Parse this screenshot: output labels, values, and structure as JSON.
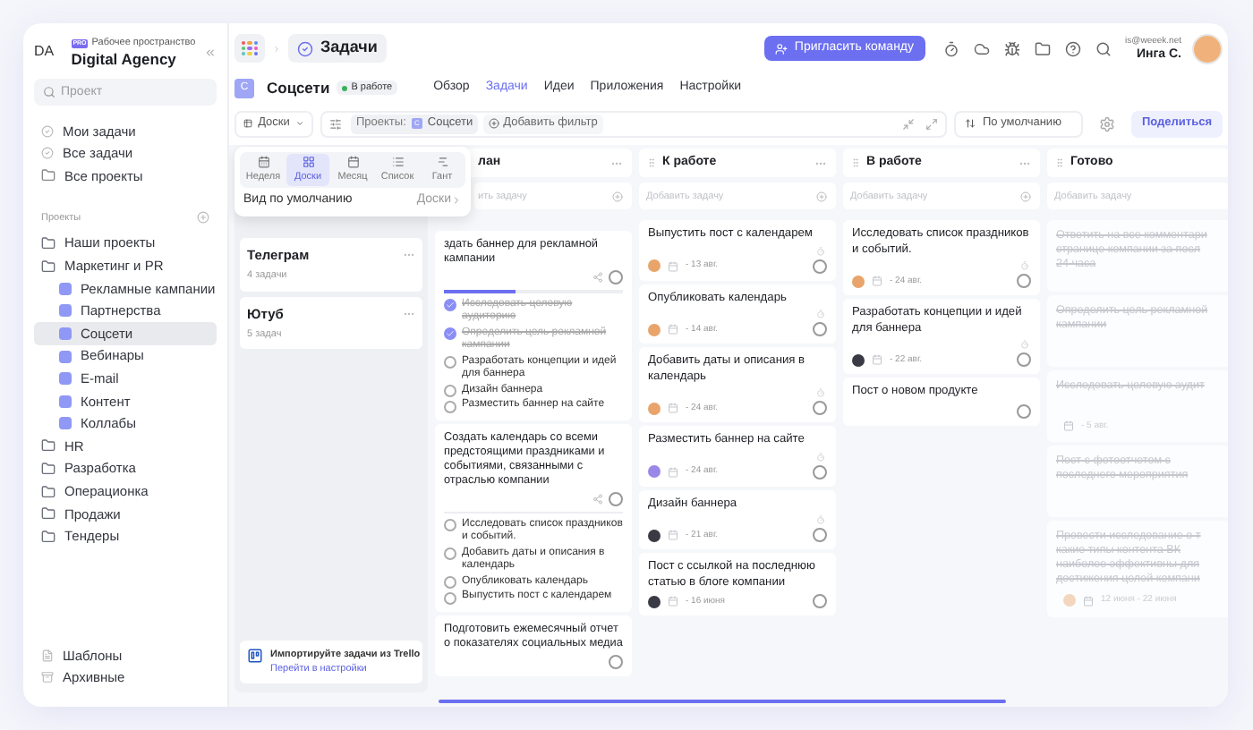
{
  "sidebar": {
    "workspace_initials": "DA",
    "badge": "PRO",
    "workspace_label": "Рабочее пространство",
    "workspace_name": "Digital Agency",
    "search": {
      "placeholder": "Проект"
    },
    "nav": [
      {
        "label": "Мои задачи",
        "kind": "task"
      },
      {
        "label": "Все задачи",
        "kind": "task"
      },
      {
        "label": "Все проекты",
        "kind": "folder"
      }
    ],
    "projects_label": "Проекты",
    "projects": [
      {
        "label": "Наши проекты",
        "selected": false
      },
      {
        "label": "Маркетинг и PR",
        "selected": false,
        "children": [
          {
            "label": "Рекламные кампании",
            "selected": false
          },
          {
            "label": "Партнерства",
            "selected": false
          },
          {
            "label": "Соцсети",
            "selected": true
          },
          {
            "label": "Вебинары",
            "selected": false
          },
          {
            "label": "E-mail",
            "selected": false
          },
          {
            "label": "Контент",
            "selected": false
          },
          {
            "label": "Коллабы",
            "selected": false
          }
        ]
      },
      {
        "label": "HR",
        "selected": false
      },
      {
        "label": "Разработка",
        "selected": false
      },
      {
        "label": "Операционка",
        "selected": false
      },
      {
        "label": "Продажи",
        "selected": false
      },
      {
        "label": "Тендеры",
        "selected": false
      }
    ],
    "footer": [
      {
        "label": "Шаблоны",
        "kind": "templates"
      },
      {
        "label": "Архивные",
        "kind": "archive"
      }
    ]
  },
  "header": {
    "breadcrumb": "Задачи",
    "invite_button": "Пригласить команду",
    "user": {
      "email": "is@weeek.net",
      "name": "Инга С."
    }
  },
  "project": {
    "icon_letter": "С",
    "title": "Соцсети",
    "status": "В работе",
    "tabs": [
      {
        "label": "Обзор",
        "selected": false
      },
      {
        "label": "Задачи",
        "selected": true
      },
      {
        "label": "Идеи",
        "selected": false
      },
      {
        "label": "Приложения",
        "selected": false
      },
      {
        "label": "Настройки",
        "selected": false
      }
    ]
  },
  "toolbar": {
    "view": "Доски",
    "filter_label": "Проекты:",
    "filter_chip": {
      "icon_letter": "С",
      "label": "Соцсети"
    },
    "add_filter": "Добавить фильтр",
    "sort": "По умолчанию",
    "share_button": "Поделиться"
  },
  "view_menu": {
    "options": [
      {
        "label": "Неделя",
        "kind": "week",
        "selected": false
      },
      {
        "label": "Доски",
        "kind": "boards",
        "selected": true
      },
      {
        "label": "Месяц",
        "kind": "month",
        "selected": false
      },
      {
        "label": "Список",
        "kind": "list",
        "selected": false
      },
      {
        "label": "Гант",
        "kind": "gantt",
        "selected": false
      }
    ],
    "default_label": "Вид по умолчанию",
    "default_value": "Доски"
  },
  "boards": [
    {
      "title": "Телеграм",
      "count": "4 задачи"
    },
    {
      "title": "Ютуб",
      "count": "5 задач"
    }
  ],
  "trello": {
    "text": "Импортируйте задачи из Trello",
    "link": "Перейти в настройки"
  },
  "columns": [
    {
      "kind": "checklist",
      "title": "лан",
      "add_placeholder": "ить задачу",
      "cards": [
        {
          "title": "здать баннер для рекламной кампании",
          "share": true,
          "progress": {
            "level": 0.4
          },
          "subtasks": [
            {
              "label": "Исследовать целевую аудиторию",
              "checked": true
            },
            {
              "label": "Определить цель рекламной кампании",
              "checked": true
            },
            {
              "label": "Разработать концепции и идей для баннера",
              "checked": false
            },
            {
              "label": "Дизайн баннера",
              "checked": false
            },
            {
              "label": "Разместить баннер на сайте",
              "checked": false
            }
          ]
        },
        {
          "title": "Создать календарь со всеми предстоящими праздниками и событиями, связанными с отраслью компании",
          "share": true,
          "subtasks": [
            {
              "label": "Исследовать список праздников и событий.",
              "checked": false
            },
            {
              "label": "Добавить даты и описания в календарь",
              "checked": false
            },
            {
              "label": "Опубликовать календарь",
              "checked": false
            },
            {
              "label": "Выпустить пост с календарем",
              "checked": false
            }
          ]
        },
        {
          "title": "Подготовить ежемесячный отчет о показателях социальных медиа",
          "share": false
        }
      ]
    },
    {
      "kind": "tasks",
      "title": "К работе",
      "add_placeholder": "Добавить задачу",
      "cards": [
        {
          "title": "Выпустить пост с календарем",
          "assignee": {
            "color": "#e8a46a"
          },
          "date": "- 13 авг.",
          "timer": true
        },
        {
          "title": "Опубликовать календарь",
          "assignee": {
            "color": "#e8a46a"
          },
          "date": "- 14 авг.",
          "timer": true
        },
        {
          "title": "Добавить даты и описания в календарь",
          "assignee": {
            "color": "#e8a46a"
          },
          "date": "- 24 авг.",
          "timer": true
        },
        {
          "title": "Разместить баннер на сайте",
          "assignee": {
            "color": "#9b87e8"
          },
          "date": "- 24 авг.",
          "timer": true
        },
        {
          "title": "Дизайн баннера",
          "assignee": {
            "color": "#3a3a44"
          },
          "date": "- 21 авг.",
          "timer": true
        },
        {
          "title": "Пост с ссылкой на последнюю статью в блоге компании",
          "assignee": {
            "color": "#3a3a44"
          },
          "date": "- 16 июня",
          "timer": false
        }
      ]
    },
    {
      "kind": "tasks",
      "title": "В работе",
      "add_placeholder": "Добавить задачу",
      "cards": [
        {
          "title": "Исследовать список праздников и событий.",
          "assignee": {
            "color": "#e8a46a"
          },
          "date": "- 24 авг.",
          "timer": true
        },
        {
          "title": "Разработать концепции и идей для баннера",
          "assignee": {
            "color": "#3a3a44"
          },
          "date": "- 22 авг.",
          "timer": true
        },
        {
          "title": "Пост о новом продукте",
          "timer": false
        }
      ]
    },
    {
      "kind": "done",
      "title": "Готово",
      "add_placeholder": "Добавить задачу",
      "cards": [
        {
          "lines": [
            "Ответить на все комментари",
            "странице компании за посл",
            "24 часа"
          ]
        },
        {
          "lines": [
            "Определить цель рекламной",
            "кампании"
          ]
        },
        {
          "lines": [
            "Исследовать целевую аудит"
          ],
          "date": "- 5 авг."
        },
        {
          "lines": [
            "Пост с фотоотчетом с",
            "последнего мероприятия"
          ]
        },
        {
          "lines": [
            "Провести исследование о т",
            "какие типы контента ВК",
            "наиболее эффективны для",
            "достижения целей компани"
          ],
          "assignee": {
            "color": "#f3d6bd"
          },
          "date": "12 июня - 22 июня"
        }
      ]
    }
  ]
}
